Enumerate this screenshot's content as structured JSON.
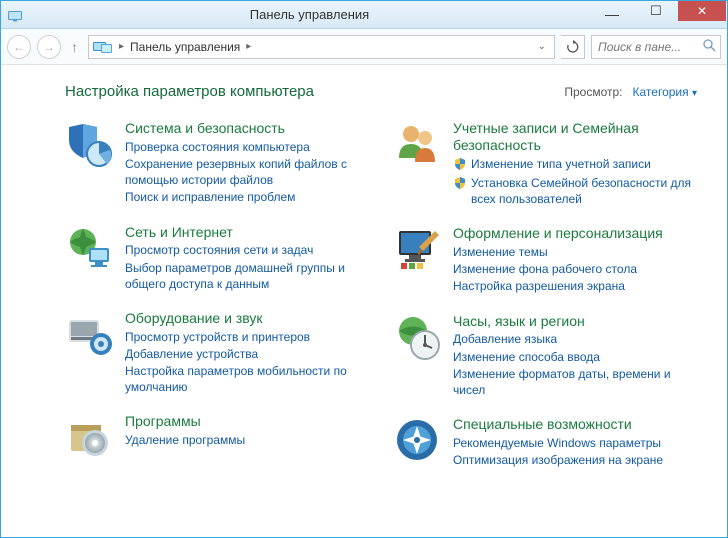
{
  "titlebar": {
    "title": "Панель управления"
  },
  "navbar": {
    "breadcrumb": "Панель управления",
    "search_placeholder": "Поиск в пане..."
  },
  "page": {
    "title": "Настройка параметров компьютера",
    "view_label": "Просмотр:",
    "view_value": "Категория"
  },
  "left": [
    {
      "title": "Система и безопасность",
      "links": [
        {
          "text": "Проверка состояния компьютера"
        },
        {
          "text": "Сохранение резервных копий файлов с помощью истории файлов"
        },
        {
          "text": "Поиск и исправление проблем"
        }
      ]
    },
    {
      "title": "Сеть и Интернет",
      "links": [
        {
          "text": "Просмотр состояния сети и задач"
        },
        {
          "text": "Выбор параметров домашней группы и общего доступа к данным"
        }
      ]
    },
    {
      "title": "Оборудование и звук",
      "links": [
        {
          "text": "Просмотр устройств и принтеров"
        },
        {
          "text": "Добавление устройства"
        },
        {
          "text": "Настройка параметров мобильности по умолчанию"
        }
      ]
    },
    {
      "title": "Программы",
      "links": [
        {
          "text": "Удаление программы"
        }
      ]
    }
  ],
  "right": [
    {
      "title": "Учетные записи и Семейная безопасность",
      "links": [
        {
          "text": "Изменение типа учетной записи",
          "shield": true
        },
        {
          "text": "Установка Семейной безопасности для всех пользователей",
          "shield": true
        }
      ]
    },
    {
      "title": "Оформление и персонализация",
      "links": [
        {
          "text": "Изменение темы"
        },
        {
          "text": "Изменение фона рабочего стола"
        },
        {
          "text": "Настройка разрешения экрана"
        }
      ]
    },
    {
      "title": "Часы, язык и регион",
      "links": [
        {
          "text": "Добавление языка"
        },
        {
          "text": "Изменение способа ввода"
        },
        {
          "text": "Изменение форматов даты, времени и чисел"
        }
      ]
    },
    {
      "title": "Специальные возможности",
      "links": [
        {
          "text": "Рекомендуемые Windows параметры"
        },
        {
          "text": "Оптимизация изображения на экране"
        }
      ]
    }
  ]
}
